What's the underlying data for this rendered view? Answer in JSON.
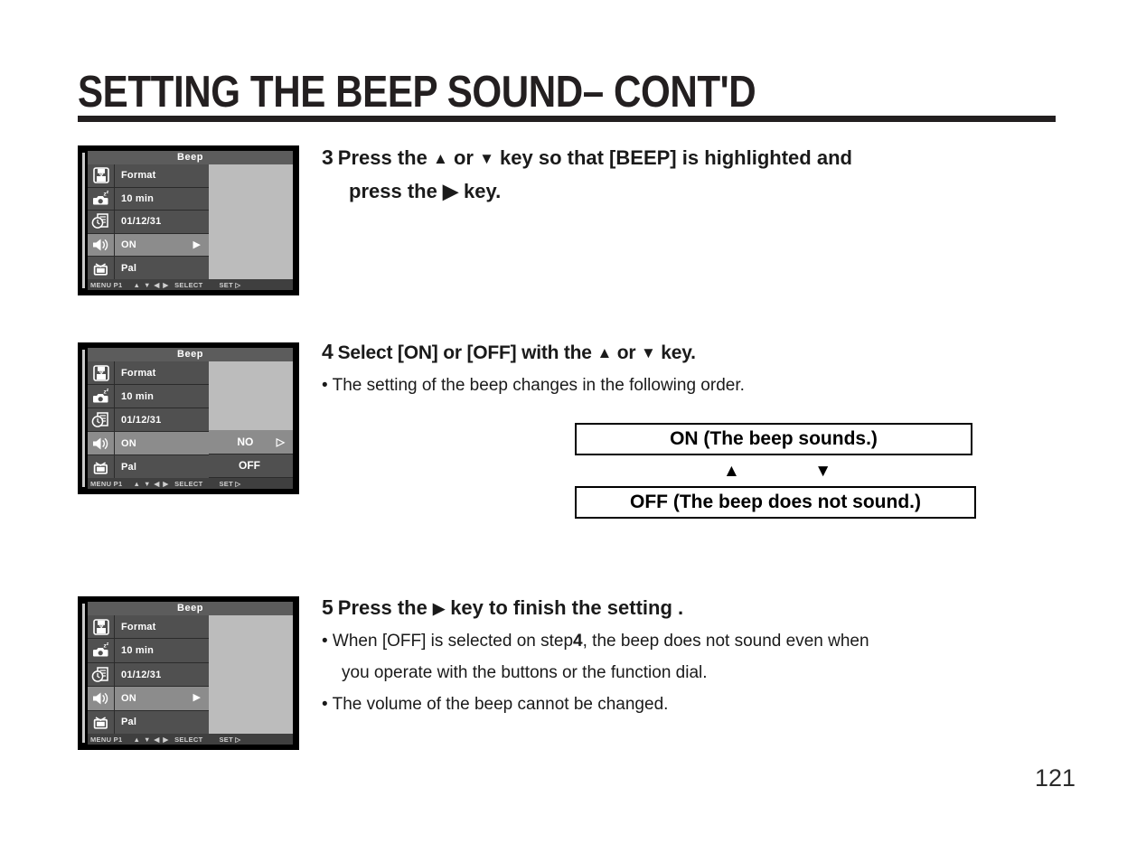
{
  "page": {
    "title": "SETTING THE BEEP SOUND– CONT'D",
    "number": "121"
  },
  "lcd_common": {
    "header": "Beep",
    "rows": [
      {
        "icon": "format-card-icon",
        "label": "Format"
      },
      {
        "icon": "camera-sleep-icon",
        "label": "10 min"
      },
      {
        "icon": "clock-date-icon",
        "label": "01/12/31"
      },
      {
        "icon": "speaker-beep-icon",
        "label": "ON",
        "arrow": "▶",
        "selected": true
      },
      {
        "icon": "tv-video-icon",
        "label": "Pal"
      }
    ],
    "statusbar": {
      "menu": "MENU P1",
      "keys": "▲ ▼ ◀ ▶",
      "select": "SELECT",
      "set": "SET ▷"
    }
  },
  "lcd_screens": [
    {
      "name": "lcd-step3",
      "submenu": []
    },
    {
      "name": "lcd-step4",
      "submenu": [
        {
          "label": "NO",
          "arrow": "▷",
          "selected": true
        },
        {
          "label": "OFF",
          "arrow": "",
          "selected": false
        }
      ]
    },
    {
      "name": "lcd-step5",
      "submenu": []
    }
  ],
  "steps": {
    "step3": {
      "number": "3",
      "line1_a": "Press the",
      "up": "▲",
      "or": "or",
      "down": "▼",
      "line1_b": "key so that [BEEP] is highlighted and",
      "line2_a": "press the",
      "right": "▶",
      "line2_b": "key."
    },
    "step4": {
      "number": "4",
      "line1_a": "Select [ON] or [OFF] with the",
      "up": "▲",
      "or": "or",
      "down": "▼",
      "line1_b": "key.",
      "bullet1": "• The setting of the beep changes in the following order."
    },
    "step5": {
      "number": "5",
      "line1_a": "Press the",
      "right": "▶",
      "line1_b": "key to finish the setting .",
      "bullet1_a": "• When [OFF] is selected on step",
      "bullet1_num": "4",
      "bullet1_b": ", the beep does not sound even when",
      "bullet1_cont": "you operate with the buttons or the function dial.",
      "bullet2": "• The volume of the beep cannot be changed."
    }
  },
  "order_diagram": {
    "box_on": "ON (The beep sounds.)",
    "box_off": "OFF (The beep does not sound.)",
    "arrow_up": "▲",
    "arrow_down": "▼"
  },
  "colors": {
    "ink": "#231f20",
    "lcd_bezel": "#000000",
    "lcd_row": "#505050",
    "lcd_row_selected": "#8c8c8c",
    "lcd_panel": "#bcbcbc",
    "lcd_header": "#5c5c5c",
    "lcd_statusbar": "#3f3f3f"
  }
}
